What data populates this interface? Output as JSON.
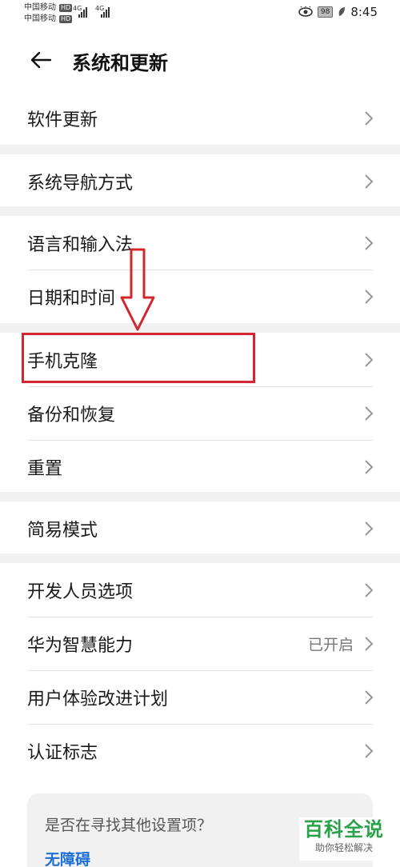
{
  "status_bar": {
    "carrier1": "中国移动",
    "carrier2": "中国移动",
    "hd1": "HD",
    "hd2": "HD",
    "net1": "4G",
    "net2": "4G",
    "battery": "98",
    "time": "8:45"
  },
  "header": {
    "title": "系统和更新"
  },
  "groups": [
    {
      "items": [
        {
          "label": "软件更新"
        }
      ]
    },
    {
      "items": [
        {
          "label": "系统导航方式"
        }
      ]
    },
    {
      "items": [
        {
          "label": "语言和输入法"
        },
        {
          "label": "日期和时间"
        }
      ]
    },
    {
      "items": [
        {
          "label": "手机克隆"
        },
        {
          "label": "备份和恢复"
        },
        {
          "label": "重置"
        }
      ]
    },
    {
      "items": [
        {
          "label": "简易模式"
        }
      ]
    },
    {
      "items": [
        {
          "label": "开发人员选项"
        },
        {
          "label": "华为智慧能力",
          "value": "已开启"
        },
        {
          "label": "用户体验改进计划"
        },
        {
          "label": "认证标志"
        }
      ]
    }
  ],
  "suggest": {
    "question": "是否在寻找其他设置项？",
    "link": "无障碍"
  },
  "watermark": {
    "main": "百科全说",
    "sub": "助你轻松解决"
  },
  "colors": {
    "highlight": "#d3262f",
    "link": "#1e6fd9",
    "watermark": "#2aa24a"
  }
}
